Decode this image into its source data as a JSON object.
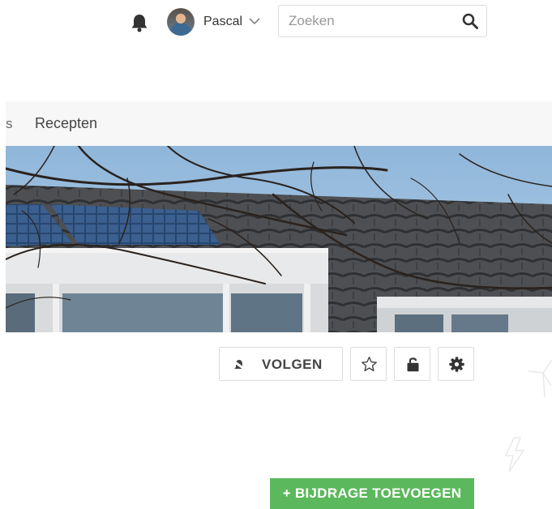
{
  "header": {
    "user_name": "Pascal",
    "search_placeholder": "Zoeken",
    "icons": [
      "bell-icon",
      "avatar",
      "chevron-down-icon",
      "search-icon"
    ]
  },
  "nav": {
    "partial_item": "s",
    "items": [
      {
        "label": "Recepten"
      }
    ]
  },
  "actions": {
    "follow_label": "VOLGEN",
    "icons": [
      "bell-muted-icon",
      "star-icon",
      "lock-icon",
      "gear-icon"
    ]
  },
  "add_contribution": {
    "label": "+ BIJDRAGE TOEVOEGEN"
  },
  "colors": {
    "accent_green": "#5cb85c",
    "icon_dark": "#333333",
    "nav_bg": "#f7f7f7"
  }
}
